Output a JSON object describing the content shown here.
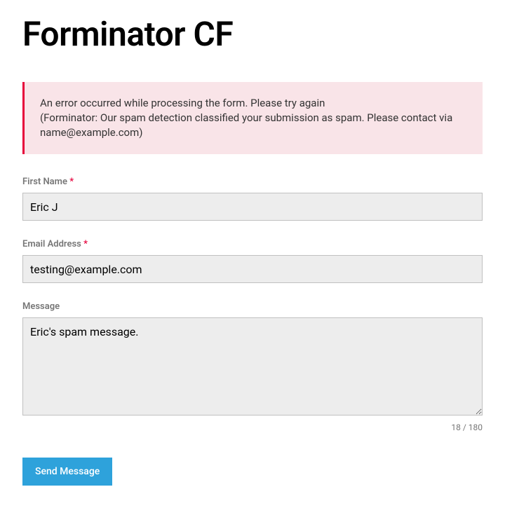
{
  "page": {
    "title": "Forminator CF"
  },
  "error": {
    "line1": "An error occurred while processing the form. Please try again",
    "line2": "(Forminator: Our spam detection classified your submission as spam. Please contact via name@example.com)"
  },
  "form": {
    "first_name": {
      "label": "First Name",
      "required": "*",
      "value": "Eric J"
    },
    "email": {
      "label": "Email Address",
      "required": "*",
      "value": "testing@example.com"
    },
    "message": {
      "label": "Message",
      "value": "Eric's spam message.",
      "counter": "18 / 180"
    },
    "submit_label": "Send Message"
  }
}
